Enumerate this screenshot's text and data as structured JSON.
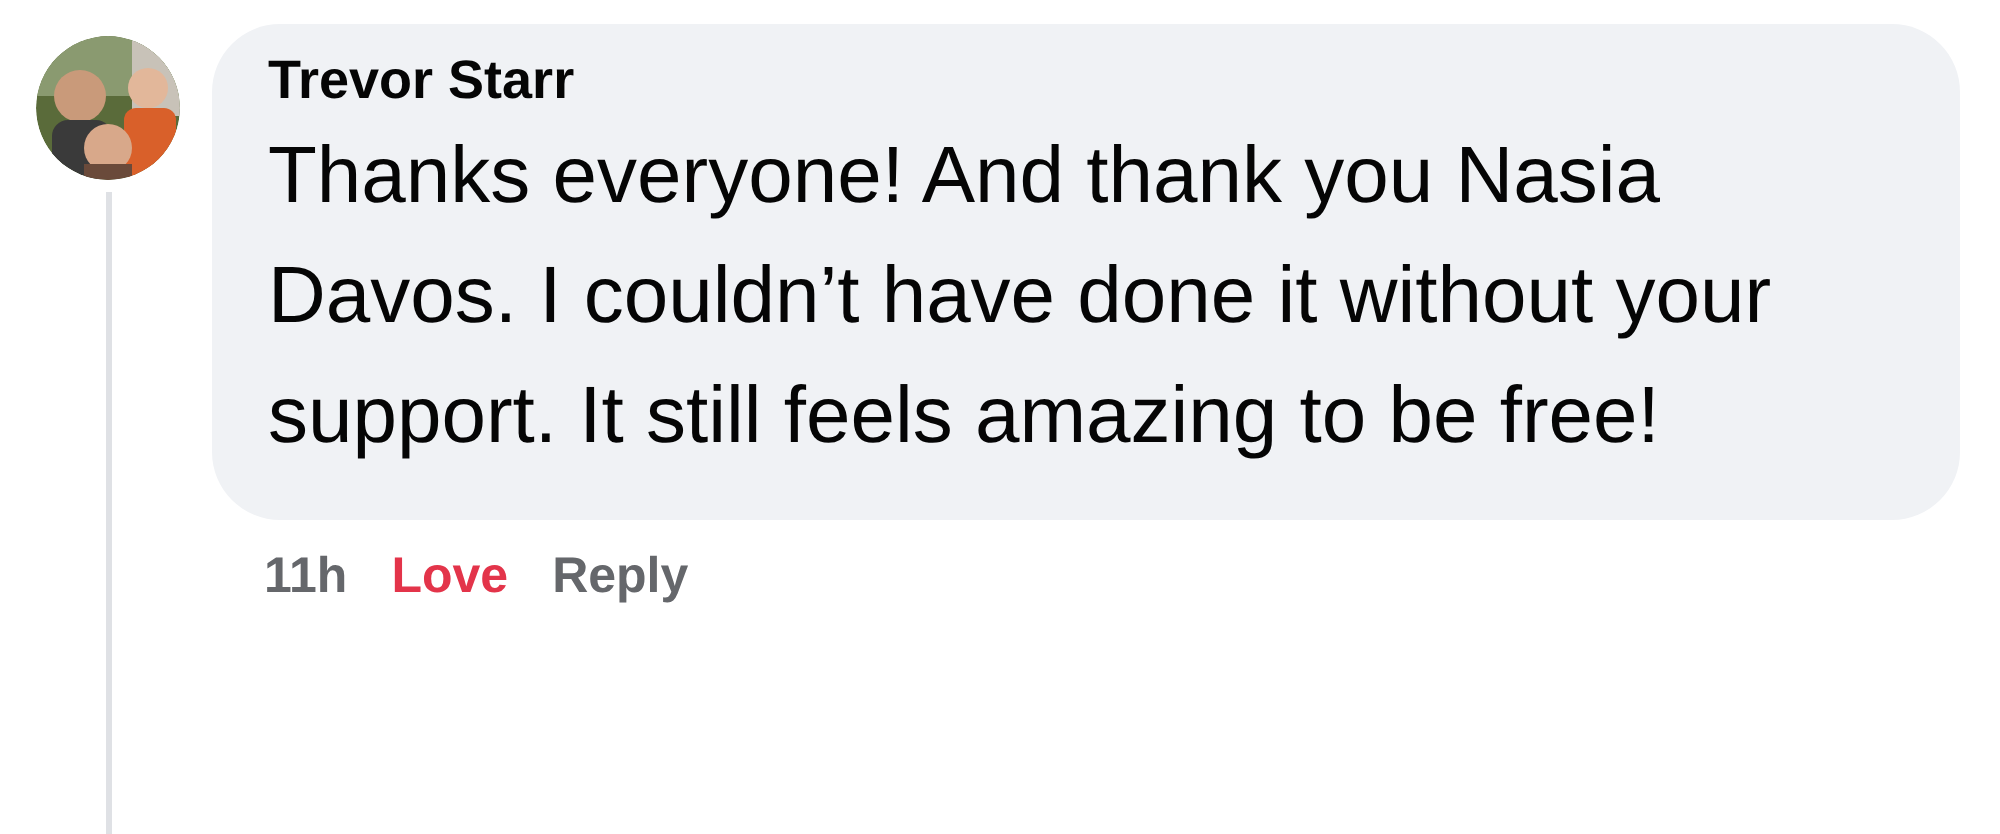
{
  "comment": {
    "author": "Trevor Starr",
    "text": "Thanks everyone! And thank you Nasia Davos. I couldn’t have done it without your support. It still feels amazing to be free!",
    "actions": [
      {
        "kind": "time",
        "label": "11h"
      },
      {
        "kind": "reaction",
        "label": "Love",
        "selected": true
      },
      {
        "kind": "reply",
        "label": "Reply"
      }
    ]
  }
}
